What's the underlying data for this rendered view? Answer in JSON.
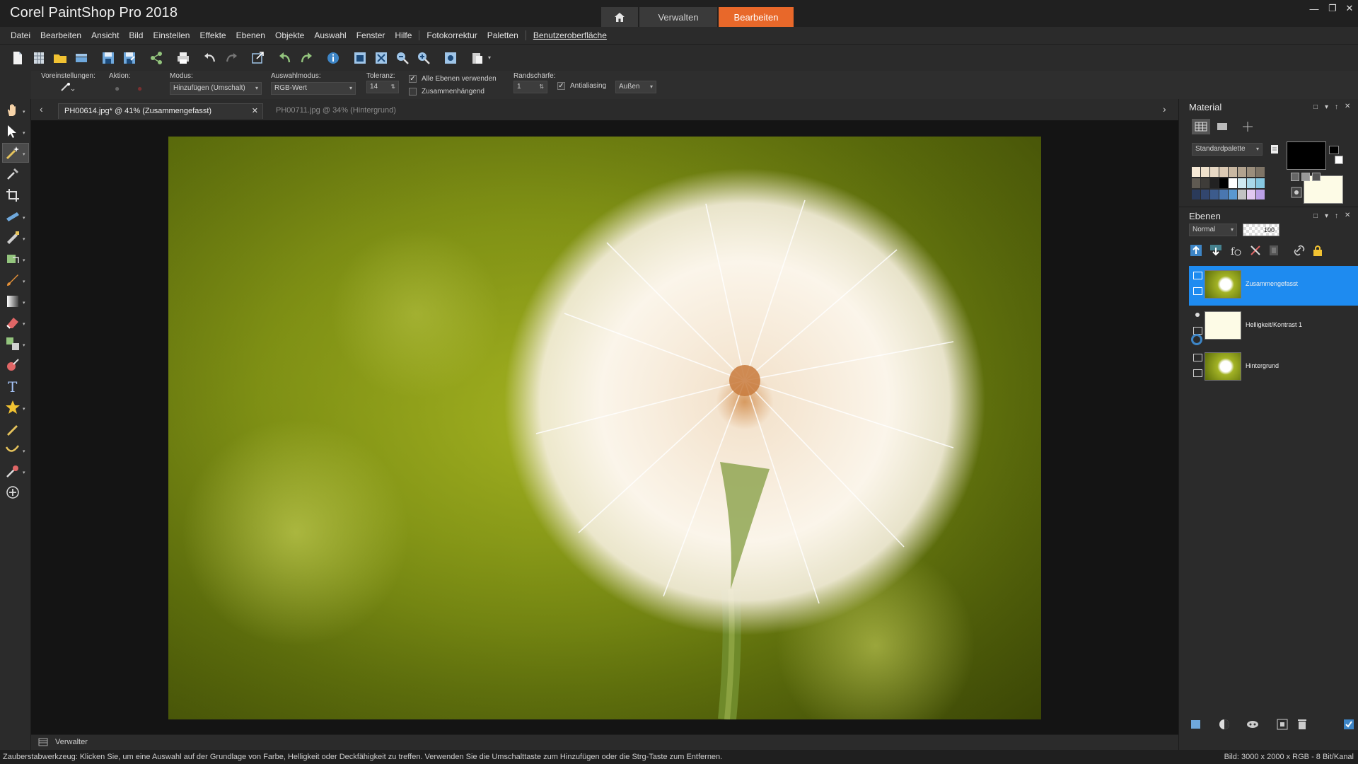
{
  "app": {
    "title": "Corel PaintShop Pro 2018",
    "tabs": {
      "manage": "Verwalten",
      "edit": "Bearbeiten"
    },
    "accent": "#e8682a",
    "selection_blue": "#1e8bf0"
  },
  "menu": [
    "Datei",
    "Bearbeiten",
    "Ansicht",
    "Bild",
    "Einstellen",
    "Effekte",
    "Ebenen",
    "Objekte",
    "Auswahl",
    "Fenster",
    "Hilfe",
    "Fotokorrektur",
    "Paletten",
    "Benutzeroberfläche"
  ],
  "toolbar_icons": [
    "new-icon",
    "new-from-grid-icon",
    "open-icon",
    "scan-icon",
    "save-icon",
    "save-as-icon",
    "share-icon",
    "print-icon",
    "undo-icon",
    "redo-icon",
    "resize-icon",
    "undo-history-icon",
    "redo-history-icon",
    "info-icon",
    "fit-window-icon",
    "fit-image-icon",
    "zoom-out-icon",
    "zoom-in-icon",
    "zoom-actual-icon",
    "paste-icon"
  ],
  "options": {
    "presets_label": "Voreinstellungen:",
    "action_label": "Aktion:",
    "mode_label": "Modus:",
    "mode_value": "Hinzufügen (Umschalt)",
    "match_mode_label": "Auswahlmodus:",
    "match_mode_value": "RGB-Wert",
    "tolerance_label": "Toleranz:",
    "tolerance_value": "14",
    "use_all_layers": "Alle Ebenen verwenden",
    "contiguous": "Zusammenhängend",
    "feather_label": "Randschärfe:",
    "feather_value": "1",
    "antialias": "Antialiasing",
    "antialias_mode": "Außen"
  },
  "documents": [
    {
      "label": "PH00614.jpg* @  41% (Zusammengefasst)",
      "active": true
    },
    {
      "label": "PH00711.jpg @  34% (Hintergrund)",
      "active": false
    }
  ],
  "organizer": {
    "label": "Verwalter"
  },
  "material": {
    "title": "Material",
    "palette": "Standardpalette",
    "foreground": "#000000",
    "background": "#fdfbe6",
    "swatches": [
      "#f6e9d6",
      "#efe1cc",
      "#e7d8c4",
      "#dccab4",
      "#c9b8a2",
      "#b2a38f",
      "#9b8e7c",
      "#7e7466",
      "#5f5a52",
      "#3e3c39",
      "#222222",
      "#000000",
      "#ffffff",
      "#cfe9f2",
      "#a9d8ea",
      "#87c8e2",
      "#2a3a5a",
      "#32466e",
      "#3c5b8c",
      "#4a77b0",
      "#5a98d0",
      "#c2c2c2",
      "#e2c9f0",
      "#bba0e6"
    ]
  },
  "layers": {
    "title": "Ebenen",
    "blend_mode": "Normal",
    "opacity": "100",
    "items": [
      {
        "name": "Zusammengefasst",
        "selected": true
      },
      {
        "name": "Helligkeit/Kontrast 1",
        "selected": false
      },
      {
        "name": "Hintergrund",
        "selected": false
      }
    ]
  },
  "status": {
    "hint": "Zauberstabwerkzeug: Klicken Sie, um eine Auswahl auf der Grundlage von Farbe, Helligkeit oder Deckfähigkeit zu treffen. Verwenden Sie die Umschalttaste zum Hinzufügen oder die Strg-Taste zum Entfernen.",
    "image_info": "Bild:  3000 x 2000 x RGB - 8 Bit/Kanal"
  }
}
